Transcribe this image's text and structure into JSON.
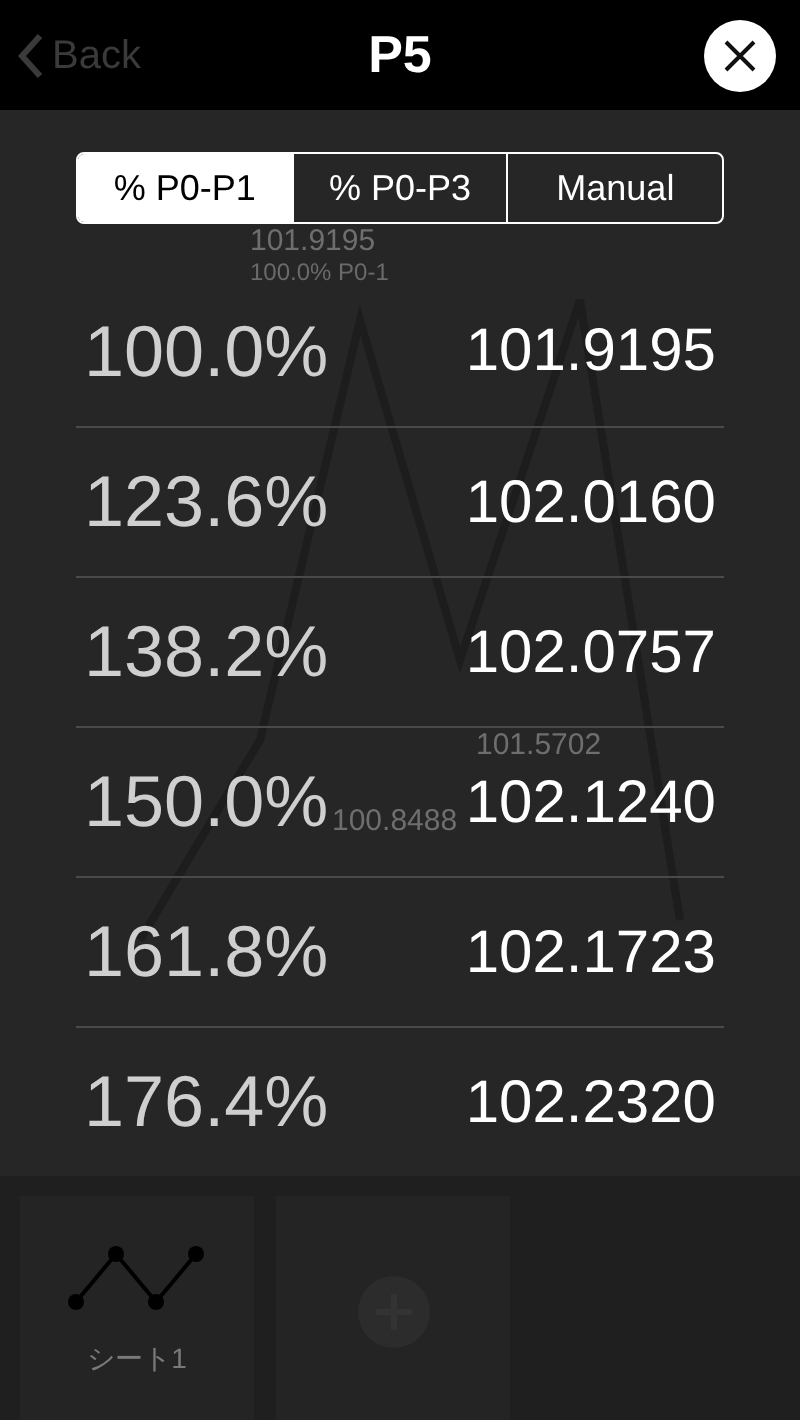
{
  "header": {
    "back": "Back",
    "title": "P5"
  },
  "tabs": [
    {
      "label": "% P0-P1",
      "selected": true
    },
    {
      "label": "% P0-P3",
      "selected": false
    },
    {
      "label": "Manual",
      "selected": false
    }
  ],
  "levels": [
    {
      "percent": "100.0%",
      "value": "101.9195"
    },
    {
      "percent": "123.6%",
      "value": "102.0160"
    },
    {
      "percent": "138.2%",
      "value": "102.0757"
    },
    {
      "percent": "150.0%",
      "value": "102.1240"
    },
    {
      "percent": "161.8%",
      "value": "102.1723"
    },
    {
      "percent": "176.4%",
      "value": "102.2320"
    }
  ],
  "background_chart": {
    "labels": [
      {
        "value": "101.9195",
        "caption": "100.0% P0-1"
      },
      {
        "value": "101.5702"
      },
      {
        "value": "100.8488"
      }
    ]
  },
  "sheets": [
    {
      "kind": "sheet",
      "label": "シート1"
    },
    {
      "kind": "add"
    }
  ]
}
